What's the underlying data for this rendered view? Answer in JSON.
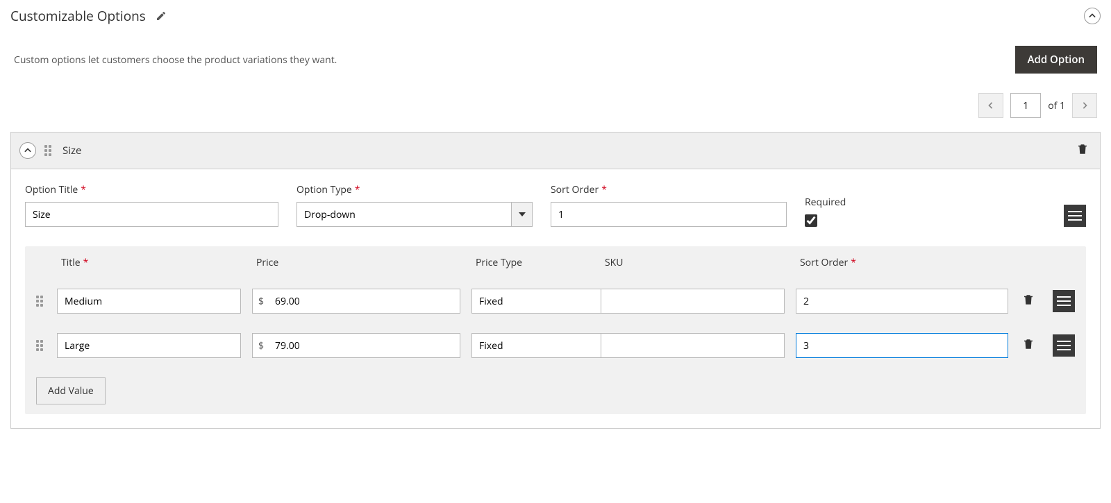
{
  "section": {
    "title": "Customizable Options",
    "intro": "Custom options let customers choose the product variations they want.",
    "add_option_btn": "Add Option"
  },
  "pager": {
    "current": "1",
    "of_label": "of",
    "total": "1"
  },
  "option": {
    "name": "Size",
    "fields": {
      "title_label": "Option Title",
      "title_value": "Size",
      "type_label": "Option Type",
      "type_value": "Drop-down",
      "sort_label": "Sort Order",
      "sort_value": "1",
      "required_label": "Required"
    },
    "values": {
      "head": {
        "title": "Title",
        "price": "Price",
        "price_type": "Price Type",
        "sku": "SKU",
        "sort": "Sort Order"
      },
      "rows": [
        {
          "title": "Medium",
          "currency": "$",
          "price": "69.00",
          "price_type": "Fixed",
          "sku": "",
          "sort": "2"
        },
        {
          "title": "Large",
          "currency": "$",
          "price": "79.00",
          "price_type": "Fixed",
          "sku": "",
          "sort": "3"
        }
      ],
      "add_btn": "Add Value"
    }
  }
}
